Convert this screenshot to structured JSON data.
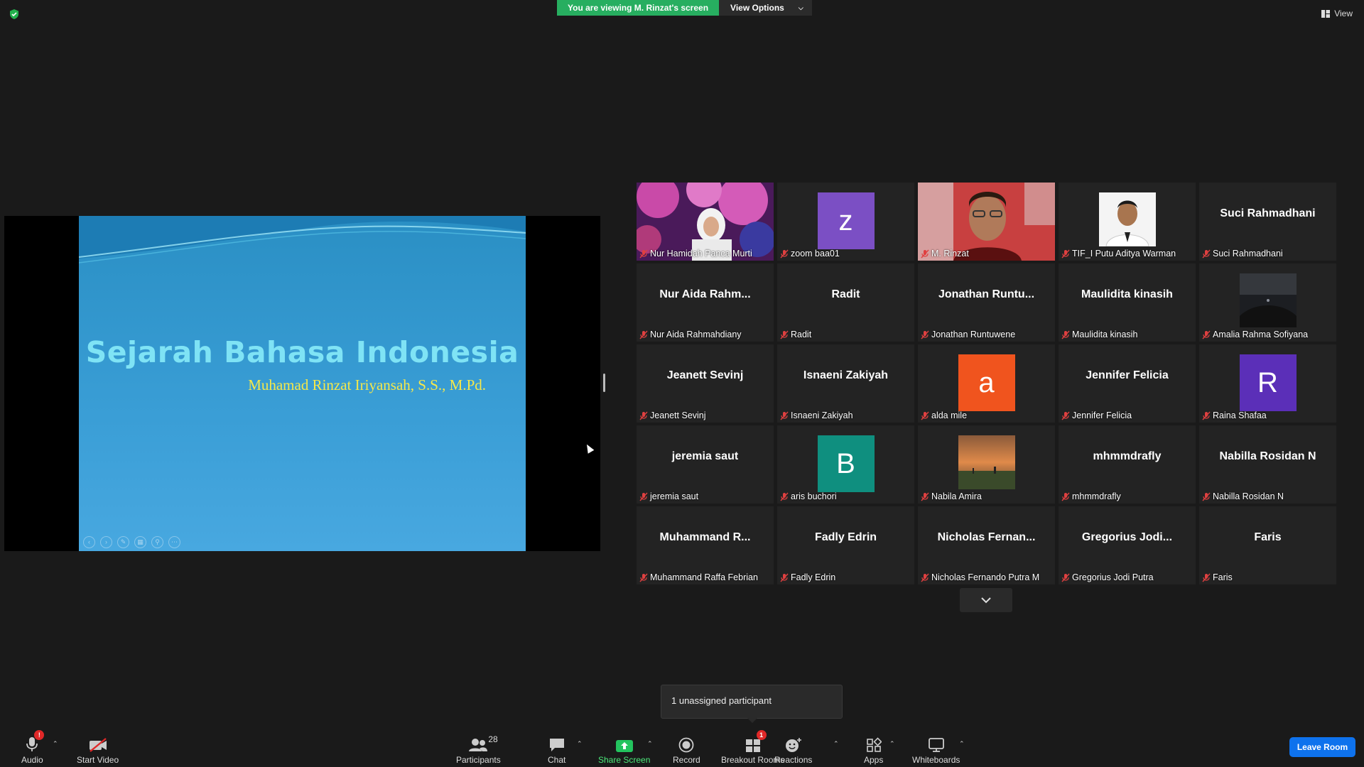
{
  "banner": {
    "viewing_text": "You are viewing M. Rinzat's screen",
    "view_options_label": "View Options"
  },
  "view_label": "View",
  "slide": {
    "title": "Sejarah Bahasa Indonesia",
    "author": "Muhamad Rinzat Iriyansah, S.S., M.Pd."
  },
  "tiles": [
    {
      "bigname": "",
      "caption": "Nur Hamidah Panca Murti",
      "kind": "photo-flowers"
    },
    {
      "bigname": "",
      "caption": "zoom baa01",
      "kind": "avatar",
      "letter": "z",
      "color": "#7b4fc4"
    },
    {
      "bigname": "",
      "caption": "M. Rinzat",
      "kind": "video-active"
    },
    {
      "bigname": "",
      "caption": "TIF_I Putu Aditya Warman",
      "kind": "photo-portrait"
    },
    {
      "bigname": "Suci Rahmadhani",
      "caption": "Suci Rahmadhani",
      "kind": "name"
    },
    {
      "bigname": "Nur Aida Rahm...",
      "caption": "Nur Aida Rahmahdiany",
      "kind": "name"
    },
    {
      "bigname": "Radit",
      "caption": "Radit",
      "kind": "name"
    },
    {
      "bigname": "Jonathan  Runtu...",
      "caption": "Jonathan Runtuwene",
      "kind": "name"
    },
    {
      "bigname": "Maulidita kinasih",
      "caption": "Maulidita kinasih",
      "kind": "name"
    },
    {
      "bigname": "",
      "caption": "Amalia Rahma Sofiyana",
      "kind": "photo-night"
    },
    {
      "bigname": "Jeanett Sevinj",
      "caption": "Jeanett Sevinj",
      "kind": "name"
    },
    {
      "bigname": "Isnaeni Zakiyah",
      "caption": "Isnaeni Zakiyah",
      "kind": "name"
    },
    {
      "bigname": "",
      "caption": "alda mile",
      "kind": "avatar",
      "letter": "a",
      "color": "#f0541e"
    },
    {
      "bigname": "Jennifer Felicia",
      "caption": "Jennifer Felicia",
      "kind": "name"
    },
    {
      "bigname": "",
      "caption": "Raina Shafaa",
      "kind": "avatar",
      "letter": "R",
      "color": "#5b2fb8"
    },
    {
      "bigname": "jeremia saut",
      "caption": "jeremia saut",
      "kind": "name"
    },
    {
      "bigname": "",
      "caption": "aris buchori",
      "kind": "avatar",
      "letter": "B",
      "color": "#0f8f7f"
    },
    {
      "bigname": "",
      "caption": "Nabila Amira",
      "kind": "photo-sunset"
    },
    {
      "bigname": "mhmmdrafly",
      "caption": "mhmmdrafly",
      "kind": "name"
    },
    {
      "bigname": "Nabilla Rosidan N",
      "caption": "Nabilla Rosidan N",
      "kind": "name"
    },
    {
      "bigname": "Muhammand  R...",
      "caption": "Muhammand Raffa Febrian",
      "kind": "name"
    },
    {
      "bigname": "Fadly Edrin",
      "caption": "Fadly Edrin",
      "kind": "name"
    },
    {
      "bigname": "Nicholas  Fernan...",
      "caption": "Nicholas Fernando Putra M",
      "kind": "name"
    },
    {
      "bigname": "Gregorius  Jodi...",
      "caption": "Gregorius Jodi Putra",
      "kind": "name"
    },
    {
      "bigname": "Faris",
      "caption": "Faris",
      "kind": "name"
    }
  ],
  "tooltip": "1 unassigned participant",
  "toolbar": {
    "audio": "Audio",
    "audio_badge": "!",
    "start_video": "Start Video",
    "participants": "Participants",
    "participants_count": "28",
    "chat": "Chat",
    "share_screen": "Share Screen",
    "record": "Record",
    "breakout_rooms": "Breakout Rooms",
    "breakout_badge": "1",
    "reactions": "Reactions",
    "apps": "Apps",
    "whiteboards": "Whiteboards",
    "leave_room": "Leave Room"
  }
}
